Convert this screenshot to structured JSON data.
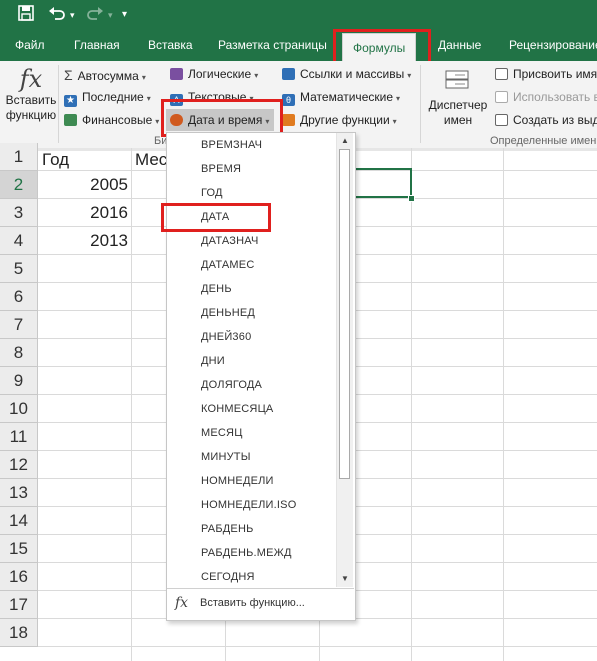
{
  "title_bar": {
    "save_icon": "save-icon",
    "undo_icon": "undo-icon",
    "redo_icon": "redo-icon",
    "customize_icon": "customize-quick-access-icon"
  },
  "tabs": [
    "Файл",
    "Главная",
    "Вставка",
    "Разметка страницы",
    "Формулы",
    "Данные",
    "Рецензирование"
  ],
  "ribbon": {
    "insert_function": [
      "Вставить",
      "функцию"
    ],
    "autosum": "Автосумма",
    "recent": "Последние",
    "financial": "Финансовые",
    "logical": "Логические",
    "text": "Текстовые",
    "datetime": "Дата и время",
    "lookup": "Ссылки и массивы",
    "math": "Математические",
    "other": "Другие функции",
    "name_manager": [
      "Диспетчер",
      "имен"
    ],
    "define_name": "Присвоить имя",
    "use_in_formula": "Использовать в",
    "create_from_selection": "Создать из выд",
    "library_label_fragment": "Би",
    "defined_names_label": "Определенные имен"
  },
  "sheet": {
    "row_numbers": [
      "1",
      "2",
      "3",
      "4",
      "5",
      "6",
      "7",
      "8",
      "9",
      "10",
      "11",
      "12",
      "13",
      "14",
      "15",
      "16",
      "17",
      "18"
    ],
    "a1": "Год",
    "b1": "Мес",
    "values": [
      "2005",
      "2016",
      "2013"
    ]
  },
  "datetime_menu": {
    "items": [
      "ВРЕМЗНАЧ",
      "ВРЕМЯ",
      "ГОД",
      "ДАТА",
      "ДАТАЗНАЧ",
      "ДАТАМЕС",
      "ДЕНЬ",
      "ДЕНЬНЕД",
      "ДНЕЙ360",
      "ДНИ",
      "ДОЛЯГОДА",
      "КОНМЕСЯЦА",
      "МЕСЯЦ",
      "МИНУТЫ",
      "НОМНЕДЕЛИ",
      "НОМНЕДЕЛИ.ISO",
      "РАБДЕНЬ",
      "РАБДЕНЬ.МЕЖД",
      "СЕГОДНЯ"
    ],
    "footer": "Вставить функцию...",
    "fx": "fx"
  },
  "colors": {
    "accent": "#217346",
    "highlight": "#e0201e"
  }
}
